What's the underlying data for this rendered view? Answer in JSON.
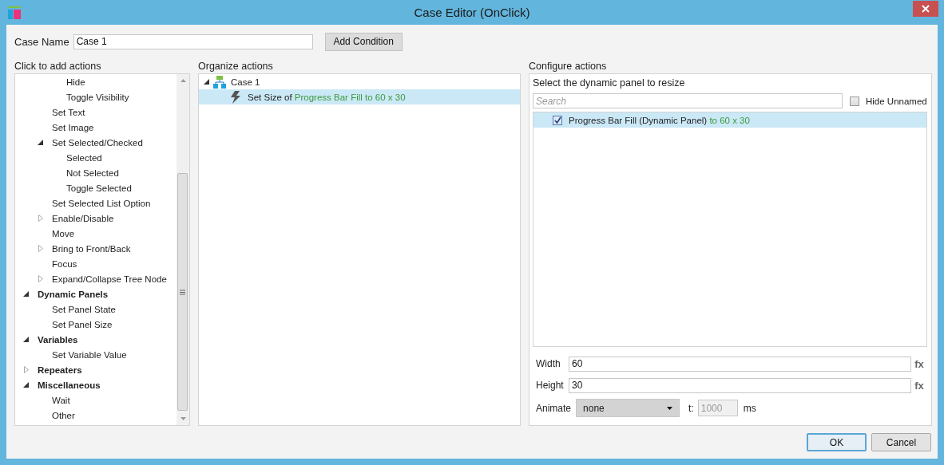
{
  "window": {
    "title": "Case Editor (OnClick)"
  },
  "case_name": {
    "label": "Case Name",
    "value": "Case 1"
  },
  "add_condition_button": "Add Condition",
  "actions_panel": {
    "title": "Click to add actions",
    "items": [
      {
        "children": [
          {
            "children": [
              {
                "label": "Hide"
              },
              {
                "label": "Toggle Visibility"
              }
            ]
          },
          {
            "label": "Set Text"
          },
          {
            "label": "Set Image"
          },
          {
            "label": "Set Selected/Checked",
            "expanded": true,
            "children": [
              {
                "label": "Selected"
              },
              {
                "label": "Not Selected"
              },
              {
                "label": "Toggle Selected"
              }
            ]
          },
          {
            "label": "Set Selected List Option"
          },
          {
            "label": "Enable/Disable",
            "expanded": false
          },
          {
            "label": "Move"
          },
          {
            "label": "Bring to Front/Back",
            "expanded": false
          },
          {
            "label": "Focus"
          },
          {
            "label": "Expand/Collapse Tree Node",
            "expanded": false
          }
        ]
      },
      {
        "label": "Dynamic Panels",
        "expanded": true,
        "children": [
          {
            "label": "Set Panel State"
          },
          {
            "label": "Set Panel Size"
          }
        ]
      },
      {
        "label": "Variables",
        "expanded": true,
        "children": [
          {
            "label": "Set Variable Value"
          }
        ]
      },
      {
        "label": "Repeaters",
        "expanded": false
      },
      {
        "label": "Miscellaneous",
        "expanded": true,
        "children": [
          {
            "label": "Wait"
          },
          {
            "label": "Other"
          }
        ]
      }
    ]
  },
  "organize_panel": {
    "title": "Organize actions",
    "cases": [
      {
        "label": "Case 1",
        "expanded": true,
        "actions": [
          {
            "text": "Set Size of",
            "detail": "Progress Bar Fill to 60 x 30",
            "selected": true
          }
        ]
      }
    ]
  },
  "configure_panel": {
    "title": "Configure actions",
    "prompt": "Select the dynamic panel to resize",
    "search": {
      "placeholder": "Search"
    },
    "hide_unnamed": {
      "label": "Hide Unnamed",
      "checked": false
    },
    "targets": [
      {
        "label": "Progress Bar Fill (Dynamic Panel)",
        "detail": "to 60 x 30",
        "checked": true,
        "selected": true
      }
    ],
    "fields": [
      {
        "label": "Width",
        "value": "60",
        "fx": "fx"
      },
      {
        "label": "Height",
        "value": "30",
        "fx": "fx"
      }
    ],
    "animate": {
      "label": "Animate",
      "value": "none",
      "time_label": "t:",
      "time_value": "1000",
      "time_disabled": true,
      "unit": "ms"
    }
  },
  "buttons": [
    {
      "label": "OK",
      "default": true
    },
    {
      "label": "Cancel",
      "default": false
    }
  ]
}
